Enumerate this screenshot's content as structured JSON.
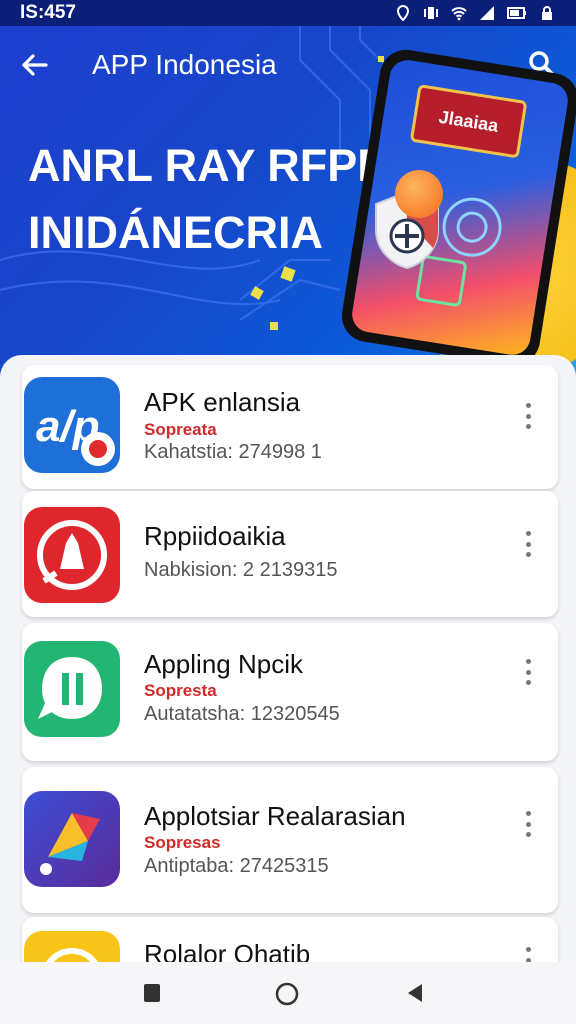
{
  "status_bar": {
    "time": "IS:457",
    "icons": [
      "location-icon",
      "vibrate-icon",
      "wifi-icon",
      "signal-icon",
      "battery-icon",
      "lock-icon"
    ]
  },
  "app_bar": {
    "title": "APP Indonesia",
    "back_icon": "arrow-left-icon",
    "search_icon": "search-icon"
  },
  "hero": {
    "line1": "ANRL RAY RFPR",
    "line2": "INIDÁNECRIA",
    "phone_badge": "Jlaaiaa"
  },
  "apps": [
    {
      "name": "APK enlansia",
      "tag": "Sopreata",
      "meta": "Kahatstia: 274998  1",
      "icon": "app-icon-apk"
    },
    {
      "name": "Rppiidoaikia",
      "tag": "",
      "meta": "Nabkision: 2 2139315",
      "icon": "app-icon-bell"
    },
    {
      "name": "Appling Npcik",
      "tag": "Sopresta",
      "meta": "Autatatsha: 12320545",
      "icon": "app-icon-chat"
    },
    {
      "name": "Applotsiar Realarasian",
      "tag": "Sopresas",
      "meta": "Antiptaba: 27425315",
      "icon": "app-icon-prism"
    },
    {
      "name": "Rolalor Ohatib",
      "tag": "",
      "meta": "",
      "icon": "app-icon-yellow"
    }
  ],
  "nav": {
    "back": "back-icon",
    "home": "home-icon",
    "recents": "recents-icon"
  },
  "colors": {
    "hero_blue": "#1f3fd0",
    "accent_red": "#d12a2a",
    "status_bar": "#0b1f78"
  }
}
